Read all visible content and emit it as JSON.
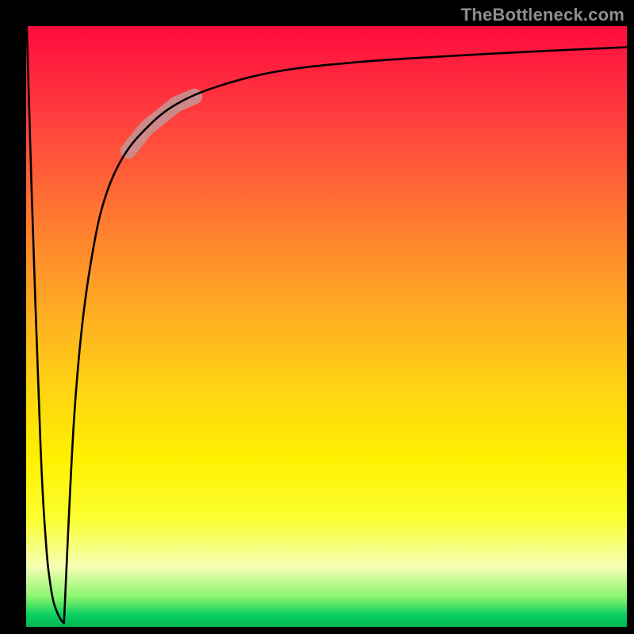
{
  "watermark": {
    "text": "TheBottleneck.com"
  },
  "gradient": {
    "stops": [
      {
        "pos": 0,
        "color": "#ff0b3c"
      },
      {
        "pos": 6,
        "color": "#ff1f3e"
      },
      {
        "pos": 14,
        "color": "#ff3a3e"
      },
      {
        "pos": 24,
        "color": "#ff5c38"
      },
      {
        "pos": 35,
        "color": "#ff842e"
      },
      {
        "pos": 48,
        "color": "#ffad22"
      },
      {
        "pos": 60,
        "color": "#ffd313"
      },
      {
        "pos": 72,
        "color": "#fff000"
      },
      {
        "pos": 82,
        "color": "#fbff30"
      },
      {
        "pos": 90,
        "color": "#f5ffb5"
      },
      {
        "pos": 95,
        "color": "#8cf56e"
      },
      {
        "pos": 98,
        "color": "#09cf60"
      },
      {
        "pos": 100,
        "color": "#02b755"
      }
    ]
  },
  "highlight_segment": {
    "color": "#c98d8c",
    "width": 20,
    "x_range_pct": [
      17,
      28
    ]
  },
  "chart_data": {
    "type": "line",
    "title": "",
    "xlabel": "",
    "ylabel": "",
    "xlim": [
      0,
      100
    ],
    "ylim": [
      0,
      100
    ],
    "grid": false,
    "legend": null,
    "series": [
      {
        "name": "left-spike",
        "x": [
          0.1,
          0.9,
          2.4,
          3.3,
          3.9,
          4.6,
          5.6,
          6.3
        ],
        "y": [
          100,
          73,
          30,
          14,
          8,
          4,
          1.5,
          0.6
        ]
      },
      {
        "name": "main-curve",
        "x": [
          6.3,
          7.0,
          8.0,
          9.3,
          11,
          13,
          16,
          20,
          25,
          32,
          42,
          55,
          70,
          85,
          100
        ],
        "y": [
          0.6,
          16,
          35,
          50,
          62,
          71,
          78,
          83,
          87,
          90,
          92.5,
          94,
          95,
          95.8,
          96.5
        ]
      }
    ],
    "annotations": [
      {
        "kind": "highlight-band",
        "on_series": "main-curve",
        "x_from": 17,
        "x_to": 28,
        "color": "#c98d8c"
      }
    ]
  }
}
